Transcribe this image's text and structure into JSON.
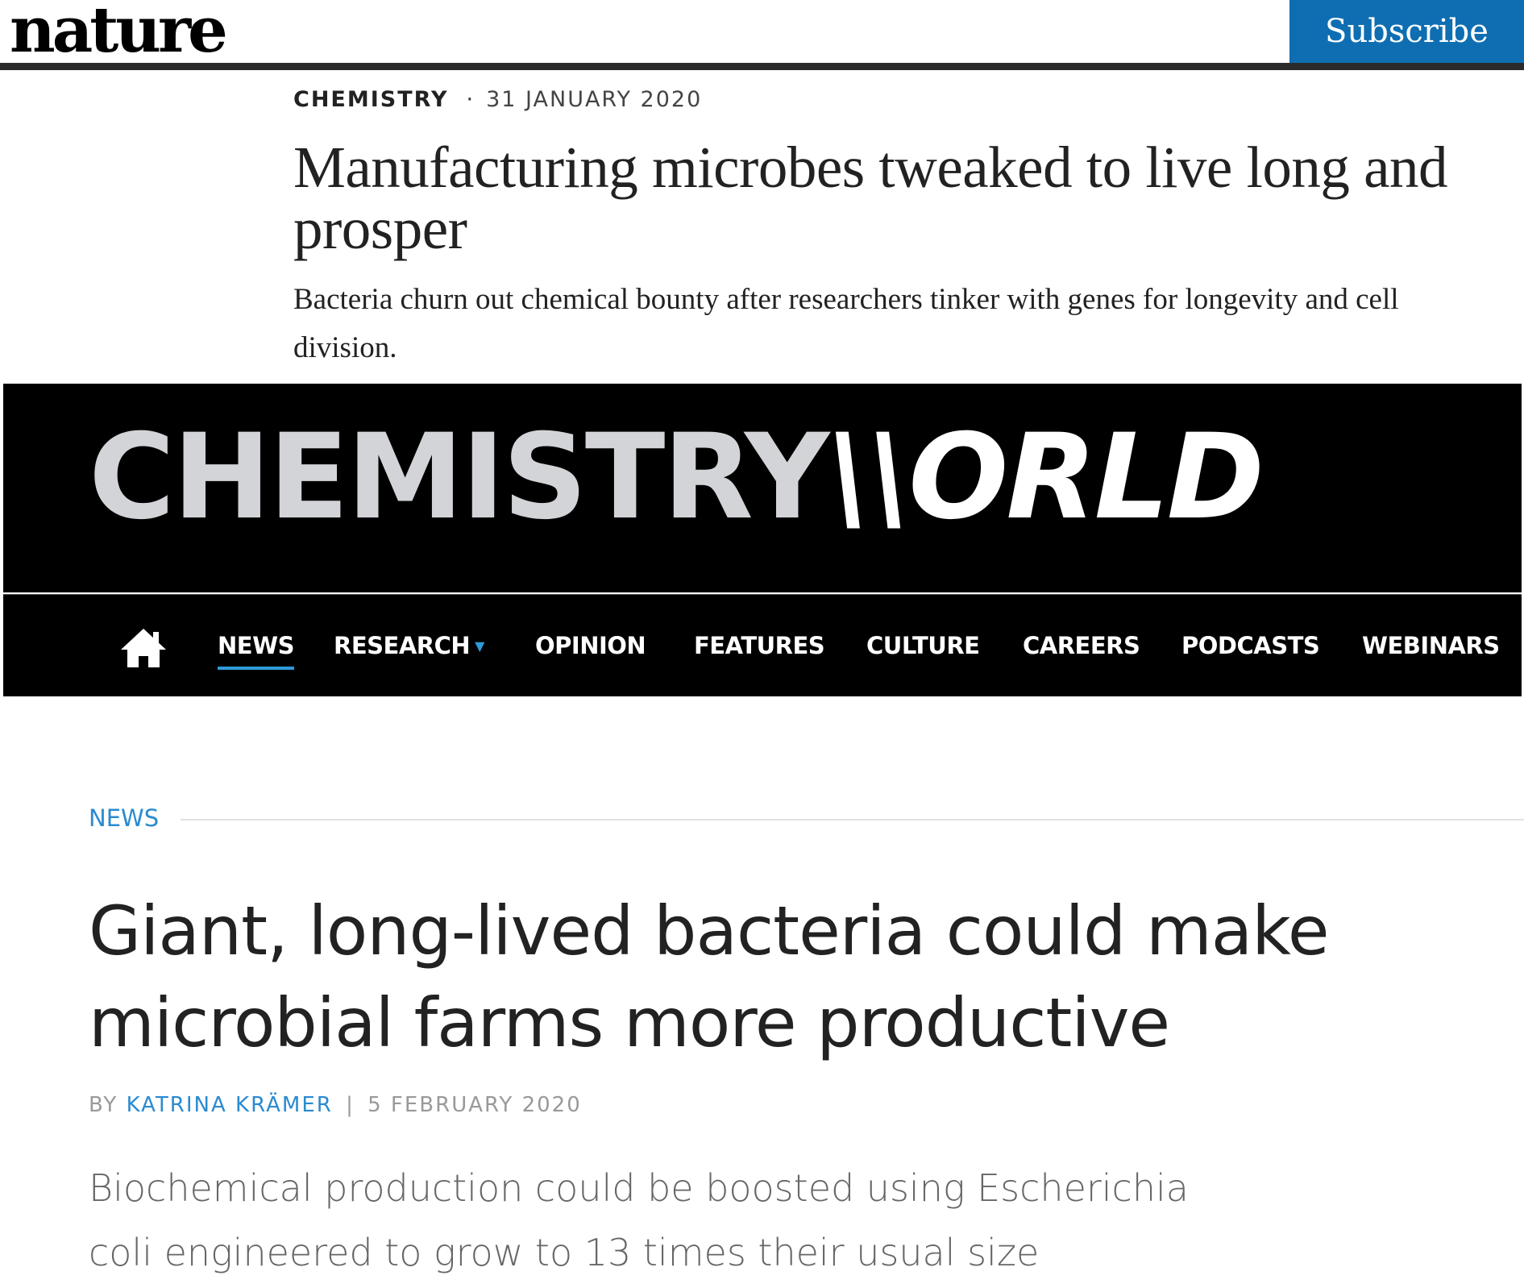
{
  "nature": {
    "logo": "nature",
    "subscribe_label": "Subscribe",
    "subject": "CHEMISTRY",
    "separator": "·",
    "date": "31 JANUARY 2020",
    "title": "Manufacturing microbes tweaked to live long and prosper",
    "standfirst": "Bacteria churn out chemical bounty after researchers tinker with genes for longevity and cell division.",
    "brand_color": "#0f6eb2"
  },
  "chemistry_world": {
    "logo_left": "CHEMISTRY",
    "logo_right": "\\\\ORLD",
    "nav": {
      "home_icon": "home-icon",
      "items": [
        {
          "label": "NEWS",
          "active": true
        },
        {
          "label": "RESEARCH",
          "has_dropdown": true
        },
        {
          "label": "OPINION"
        },
        {
          "label": "FEATURES"
        },
        {
          "label": "CULTURE"
        },
        {
          "label": "CAREERS"
        },
        {
          "label": "PODCASTS"
        },
        {
          "label": "WEBINARS"
        }
      ]
    },
    "section": "NEWS",
    "title": "Giant, long-lived bacteria could make microbial farms more productive",
    "byline_prefix": "BY",
    "author": "KATRINA KRÄMER",
    "byline_separator": "|",
    "date": "5 FEBRUARY 2020",
    "standfirst": "Biochemical production could be boosted using Escherichia coli engineered to grow to 13 times their usual size",
    "accent_color": "#2a8ad0"
  }
}
